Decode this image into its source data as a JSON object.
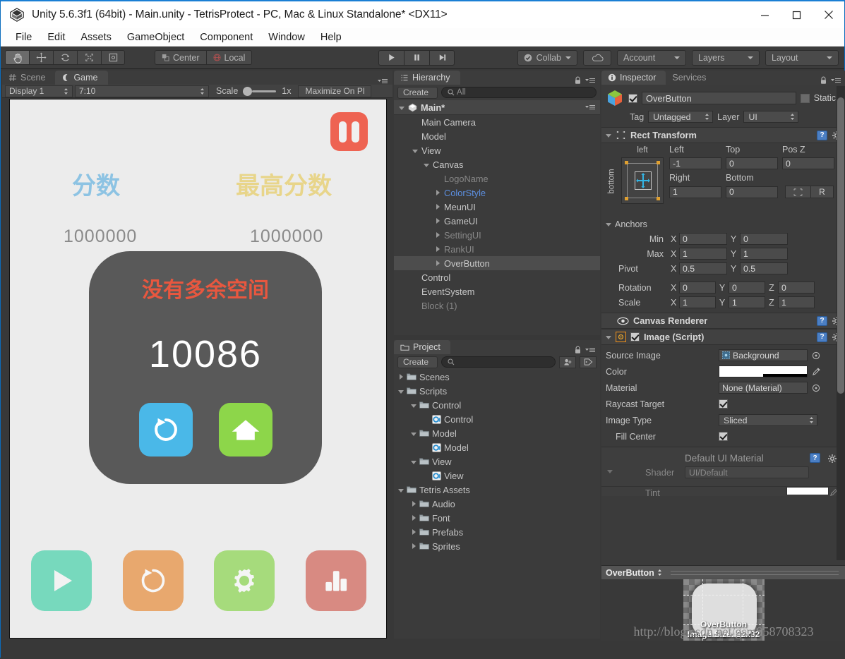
{
  "window": {
    "title": "Unity 5.6.3f1 (64bit) - Main.unity - TetrisProtect - PC, Mac & Linux Standalone* <DX11>",
    "minimize": "minimize-icon",
    "maximize": "maximize-icon",
    "close": "close-icon"
  },
  "menubar": {
    "items": [
      "File",
      "Edit",
      "Assets",
      "GameObject",
      "Component",
      "Window",
      "Help"
    ]
  },
  "toolbar": {
    "tools": [
      "hand-tool",
      "move-tool",
      "rotate-tool",
      "scale-tool",
      "rect-tool"
    ],
    "active_tool": "hand-tool",
    "pivot_mode": "Center",
    "pivot_rotation": "Local",
    "play": "play-button",
    "pause": "pause-button",
    "step": "step-button",
    "collab": "Collab",
    "cloud": "cloud-button",
    "account": "Account",
    "layers": "Layers",
    "layout": "Layout"
  },
  "gameview": {
    "tabs": [
      {
        "label": "Scene",
        "active": false,
        "icon": "scene-grid-icon"
      },
      {
        "label": "Game",
        "active": true,
        "icon": "game-moon-icon"
      }
    ],
    "display": "Display 1",
    "aspect": "7:10",
    "scale_label": "Scale",
    "scale_value": "1x",
    "maximize": "Maximize On Pl",
    "content": {
      "pause_button": "pause-game-button",
      "pause_color": "#ee6352",
      "score_label": "分数",
      "score_label_color": "#8dc3e3",
      "score_value": "1000000",
      "highscore_label": "最高分数",
      "highscore_label_color": "#e8d58a",
      "highscore_value": "1000000",
      "gameover": {
        "title": "没有多余空间",
        "title_color": "#e8573f",
        "score": "10086",
        "panel_color": "#595959",
        "retry_button": {
          "name": "retry-button",
          "color": "#4ab8e8"
        },
        "home_button": {
          "name": "home-button",
          "color": "#8dd martial"
        }
      },
      "bottom_buttons": [
        {
          "name": "play-button",
          "color": "#77d9bd",
          "icon": "play-icon"
        },
        {
          "name": "restart-button",
          "color": "#e8a86e",
          "icon": "restart-icon"
        },
        {
          "name": "settings-button",
          "color": "#a6db7c",
          "icon": "gear-icon"
        },
        {
          "name": "rank-button",
          "color": "#d88a82",
          "icon": "bar-chart-icon"
        }
      ]
    }
  },
  "hierarchy": {
    "tab": "Hierarchy",
    "create": "Create",
    "search_placeholder": "All",
    "scene_name": "Main*",
    "items": [
      {
        "label": "Main Camera",
        "indent": 1,
        "arrow": "none",
        "state": "normal"
      },
      {
        "label": "Model",
        "indent": 1,
        "arrow": "none",
        "state": "normal"
      },
      {
        "label": "View",
        "indent": 1,
        "arrow": "open",
        "state": "normal"
      },
      {
        "label": "Canvas",
        "indent": 2,
        "arrow": "open",
        "state": "normal"
      },
      {
        "label": "LogoName",
        "indent": 3,
        "arrow": "none",
        "state": "disabled"
      },
      {
        "label": "ColorStyle",
        "indent": 3,
        "arrow": "closed",
        "state": "prefab"
      },
      {
        "label": "MeunUI",
        "indent": 3,
        "arrow": "closed",
        "state": "normal"
      },
      {
        "label": "GameUI",
        "indent": 3,
        "arrow": "closed",
        "state": "normal"
      },
      {
        "label": "SettingUI",
        "indent": 3,
        "arrow": "closed",
        "state": "disabled"
      },
      {
        "label": "RankUI",
        "indent": 3,
        "arrow": "closed",
        "state": "disabled"
      },
      {
        "label": "OverButton",
        "indent": 3,
        "arrow": "closed",
        "state": "selected"
      },
      {
        "label": "Control",
        "indent": 1,
        "arrow": "none",
        "state": "normal"
      },
      {
        "label": "EventSystem",
        "indent": 1,
        "arrow": "none",
        "state": "normal"
      },
      {
        "label": "Block (1)",
        "indent": 1,
        "arrow": "none",
        "state": "disabled"
      }
    ]
  },
  "project": {
    "tab": "Project",
    "create": "Create",
    "search_placeholder": "",
    "items": [
      {
        "label": "Scenes",
        "indent": 0,
        "arrow": "closed",
        "icon": "folder-icon"
      },
      {
        "label": "Scripts",
        "indent": 0,
        "arrow": "open",
        "icon": "folder-icon"
      },
      {
        "label": "Control",
        "indent": 1,
        "arrow": "open",
        "icon": "folder-icon"
      },
      {
        "label": "Control",
        "indent": 2,
        "arrow": "none",
        "icon": "csharp-icon"
      },
      {
        "label": "Model",
        "indent": 1,
        "arrow": "open",
        "icon": "folder-icon"
      },
      {
        "label": "Model",
        "indent": 2,
        "arrow": "none",
        "icon": "csharp-icon"
      },
      {
        "label": "View",
        "indent": 1,
        "arrow": "open",
        "icon": "folder-icon"
      },
      {
        "label": "View",
        "indent": 2,
        "arrow": "none",
        "icon": "csharp-icon"
      },
      {
        "label": "Tetris Assets",
        "indent": 0,
        "arrow": "open",
        "icon": "folder-icon"
      },
      {
        "label": "Audio",
        "indent": 1,
        "arrow": "closed",
        "icon": "folder-icon"
      },
      {
        "label": "Font",
        "indent": 1,
        "arrow": "closed",
        "icon": "folder-icon"
      },
      {
        "label": "Prefabs",
        "indent": 1,
        "arrow": "closed",
        "icon": "folder-icon"
      },
      {
        "label": "Sprites",
        "indent": 1,
        "arrow": "closed",
        "icon": "folder-icon"
      }
    ]
  },
  "inspector": {
    "tabs": [
      {
        "label": "Inspector",
        "active": true
      },
      {
        "label": "Services",
        "active": false
      }
    ],
    "object": {
      "enabled": true,
      "name": "OverButton",
      "static_label": "Static",
      "static_checked": false,
      "tag_label": "Tag",
      "tag_value": "Untagged",
      "layer_label": "Layer",
      "layer_value": "UI"
    },
    "rect_transform": {
      "title": "Rect Transform",
      "anchor_preset_h": "left",
      "anchor_preset_v": "bottom",
      "left_label": "Left",
      "left_value": "-1",
      "top_label": "Top",
      "top_value": "0",
      "posz_label": "Pos Z",
      "posz_value": "0",
      "right_label": "Right",
      "right_value": "1",
      "bottom_label": "Bottom",
      "bottom_value": "0",
      "blueprint_btn": "blueprint-mode-button",
      "raw_btn": "R",
      "anchors_label": "Anchors",
      "min_label": "Min",
      "min_x": "0",
      "min_y": "0",
      "max_label": "Max",
      "max_x": "1",
      "max_y": "1",
      "pivot_label": "Pivot",
      "pivot_x": "0.5",
      "pivot_y": "0.5",
      "rotation_label": "Rotation",
      "rot_x": "0",
      "rot_y": "0",
      "rot_z": "0",
      "scale_label": "Scale",
      "scl_x": "1",
      "scl_y": "1",
      "scl_z": "1"
    },
    "canvas_renderer": {
      "title": "Canvas Renderer"
    },
    "image_script": {
      "title": "Image (Script)",
      "enabled": true,
      "source_image_label": "Source Image",
      "source_image_value": "Background",
      "color_label": "Color",
      "color_value": "#ffffff",
      "material_label": "Material",
      "material_value": "None (Material)",
      "raycast_label": "Raycast Target",
      "raycast_checked": true,
      "image_type_label": "Image Type",
      "image_type_value": "Sliced",
      "fill_center_label": "Fill Center",
      "fill_center_checked": true
    },
    "material": {
      "title": "Default UI Material",
      "shader_label": "Shader",
      "shader_value": "UI/Default",
      "tint_label": "Tint"
    },
    "preview": {
      "title": "OverButton",
      "sprite_name": "OverButton",
      "image_size": "Image Size: 32x32"
    },
    "watermark": "http://blog.csdn.net/gsm958708323"
  }
}
